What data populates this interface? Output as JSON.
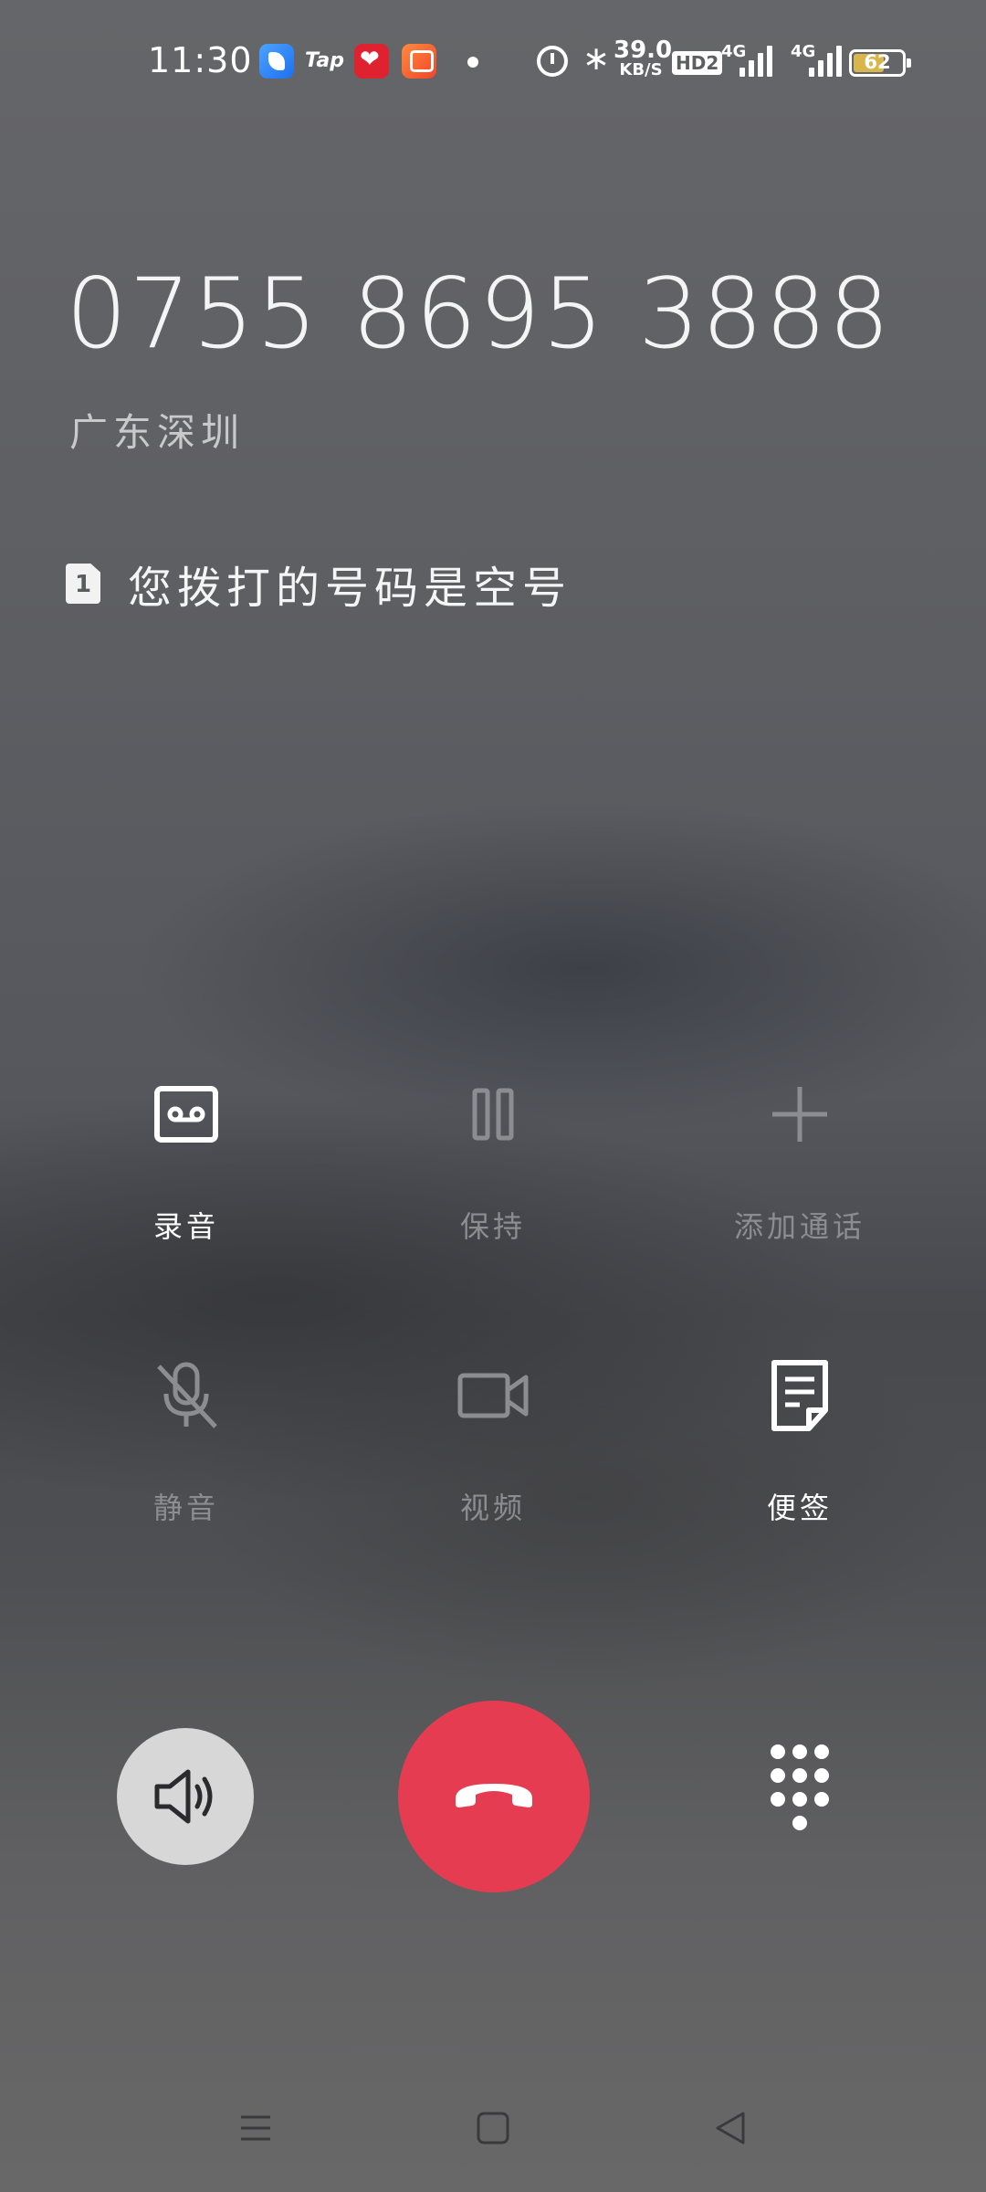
{
  "status_bar": {
    "time": "11:30",
    "apps": [
      "blue-app-icon",
      "tap-app-icon",
      "red-heart-app-icon",
      "orange-app-icon"
    ],
    "tap_label": "Tap",
    "net_speed_value": "39.0",
    "net_speed_unit": "KB/S",
    "hd_label": "HD2",
    "sim1_network": "4G",
    "sim2_network": "4G",
    "battery_level": "62",
    "battery_fill_percent": 62,
    "battery_color": "#d9b64b"
  },
  "call": {
    "number": "0755 8695 3888",
    "location": "广东深圳",
    "sim_slot": "1",
    "status_message": "您拨打的号码是空号"
  },
  "controls": {
    "record": {
      "label": "录音",
      "icon": "cassette-tape-icon",
      "enabled": true
    },
    "hold": {
      "label": "保持",
      "icon": "pause-icon",
      "enabled": false
    },
    "add_call": {
      "label": "添加通话",
      "icon": "plus-icon",
      "enabled": false
    },
    "mute": {
      "label": "静音",
      "icon": "microphone-off-icon",
      "enabled": false
    },
    "video": {
      "label": "视频",
      "icon": "video-camera-icon",
      "enabled": false
    },
    "notes": {
      "label": "便签",
      "icon": "note-icon",
      "enabled": true
    }
  },
  "actions": {
    "speaker_icon": "speaker-icon",
    "end_call_icon": "hang-up-phone-icon",
    "end_call_color": "#e63c52",
    "dialpad_icon": "dialpad-icon"
  },
  "nav": {
    "menu_icon": "menu-icon",
    "home_icon": "home-icon",
    "back_icon": "back-icon"
  }
}
